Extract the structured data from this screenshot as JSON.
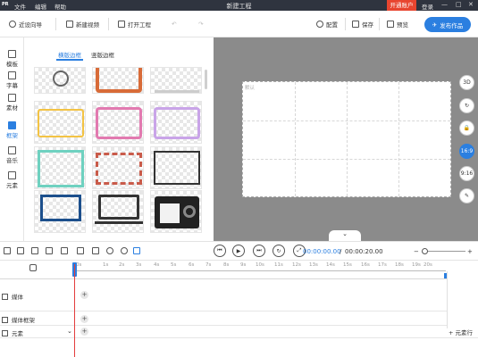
{
  "titlebar": {
    "menu": [
      "文件",
      "编辑",
      "帮助"
    ],
    "title": "新建工程",
    "vip": "开通账户",
    "login": "登录",
    "window_controls": [
      "—",
      "□",
      "✕"
    ]
  },
  "toolbar": {
    "recent": "近设向导",
    "new_video": "新建视频",
    "open_project": "打开工程",
    "config": "配置",
    "save": "保存",
    "preview": "预览",
    "publish": "发布作品"
  },
  "sidebar": {
    "items": [
      {
        "label": "模板",
        "icon": "template-icon"
      },
      {
        "label": "字幕",
        "icon": "text-icon"
      },
      {
        "label": "素材",
        "icon": "image-icon"
      },
      {
        "label": "框架",
        "icon": "frame-icon",
        "active": true
      },
      {
        "label": "音乐",
        "icon": "music-icon"
      },
      {
        "label": "元素",
        "icon": "element-icon"
      }
    ]
  },
  "panel": {
    "tabs": [
      "横版边框",
      "竖版边框"
    ],
    "active_tab": "横版边框"
  },
  "canvas": {
    "watermark": "默认",
    "collapse_symbol": "⌄"
  },
  "right_tools": [
    "3D",
    "↻",
    "🔒",
    "16:9",
    "9:16",
    "✎"
  ],
  "controls": {
    "current_time": "00:00:00.00",
    "separator": "/",
    "total_time": "00:00:20.00",
    "zoom_minus": "−",
    "zoom_plus": "+"
  },
  "timeline": {
    "ticks": [
      "0s",
      "1s",
      "2s",
      "3s",
      "4s",
      "5s",
      "6s",
      "7s",
      "8s",
      "9s",
      "10s",
      "11s",
      "12s",
      "13s",
      "14s",
      "15s",
      "16s",
      "17s",
      "18s",
      "19s",
      "20s"
    ],
    "tracks": [
      {
        "label": "媒体",
        "icon": "media-icon"
      },
      {
        "label": "媒体框架",
        "icon": "media-frame-icon"
      },
      {
        "label": "元素",
        "icon": "element-icon"
      }
    ],
    "add_track": "+ 元素行"
  }
}
